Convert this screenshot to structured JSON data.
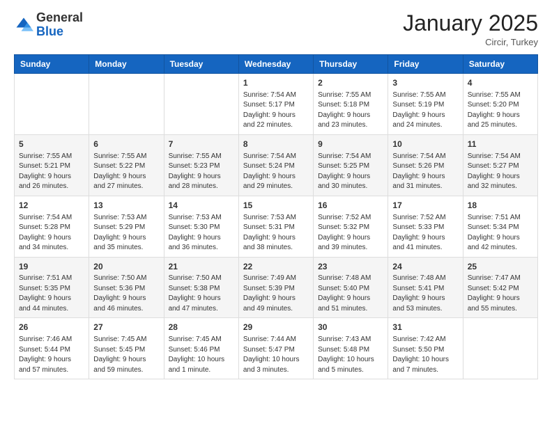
{
  "header": {
    "logo_general": "General",
    "logo_blue": "Blue",
    "month_title": "January 2025",
    "subtitle": "Circir, Turkey"
  },
  "days_of_week": [
    "Sunday",
    "Monday",
    "Tuesday",
    "Wednesday",
    "Thursday",
    "Friday",
    "Saturday"
  ],
  "weeks": [
    [
      {
        "day": "",
        "info": ""
      },
      {
        "day": "",
        "info": ""
      },
      {
        "day": "",
        "info": ""
      },
      {
        "day": "1",
        "info": "Sunrise: 7:54 AM\nSunset: 5:17 PM\nDaylight: 9 hours\nand 22 minutes."
      },
      {
        "day": "2",
        "info": "Sunrise: 7:55 AM\nSunset: 5:18 PM\nDaylight: 9 hours\nand 23 minutes."
      },
      {
        "day": "3",
        "info": "Sunrise: 7:55 AM\nSunset: 5:19 PM\nDaylight: 9 hours\nand 24 minutes."
      },
      {
        "day": "4",
        "info": "Sunrise: 7:55 AM\nSunset: 5:20 PM\nDaylight: 9 hours\nand 25 minutes."
      }
    ],
    [
      {
        "day": "5",
        "info": "Sunrise: 7:55 AM\nSunset: 5:21 PM\nDaylight: 9 hours\nand 26 minutes."
      },
      {
        "day": "6",
        "info": "Sunrise: 7:55 AM\nSunset: 5:22 PM\nDaylight: 9 hours\nand 27 minutes."
      },
      {
        "day": "7",
        "info": "Sunrise: 7:55 AM\nSunset: 5:23 PM\nDaylight: 9 hours\nand 28 minutes."
      },
      {
        "day": "8",
        "info": "Sunrise: 7:54 AM\nSunset: 5:24 PM\nDaylight: 9 hours\nand 29 minutes."
      },
      {
        "day": "9",
        "info": "Sunrise: 7:54 AM\nSunset: 5:25 PM\nDaylight: 9 hours\nand 30 minutes."
      },
      {
        "day": "10",
        "info": "Sunrise: 7:54 AM\nSunset: 5:26 PM\nDaylight: 9 hours\nand 31 minutes."
      },
      {
        "day": "11",
        "info": "Sunrise: 7:54 AM\nSunset: 5:27 PM\nDaylight: 9 hours\nand 32 minutes."
      }
    ],
    [
      {
        "day": "12",
        "info": "Sunrise: 7:54 AM\nSunset: 5:28 PM\nDaylight: 9 hours\nand 34 minutes."
      },
      {
        "day": "13",
        "info": "Sunrise: 7:53 AM\nSunset: 5:29 PM\nDaylight: 9 hours\nand 35 minutes."
      },
      {
        "day": "14",
        "info": "Sunrise: 7:53 AM\nSunset: 5:30 PM\nDaylight: 9 hours\nand 36 minutes."
      },
      {
        "day": "15",
        "info": "Sunrise: 7:53 AM\nSunset: 5:31 PM\nDaylight: 9 hours\nand 38 minutes."
      },
      {
        "day": "16",
        "info": "Sunrise: 7:52 AM\nSunset: 5:32 PM\nDaylight: 9 hours\nand 39 minutes."
      },
      {
        "day": "17",
        "info": "Sunrise: 7:52 AM\nSunset: 5:33 PM\nDaylight: 9 hours\nand 41 minutes."
      },
      {
        "day": "18",
        "info": "Sunrise: 7:51 AM\nSunset: 5:34 PM\nDaylight: 9 hours\nand 42 minutes."
      }
    ],
    [
      {
        "day": "19",
        "info": "Sunrise: 7:51 AM\nSunset: 5:35 PM\nDaylight: 9 hours\nand 44 minutes."
      },
      {
        "day": "20",
        "info": "Sunrise: 7:50 AM\nSunset: 5:36 PM\nDaylight: 9 hours\nand 46 minutes."
      },
      {
        "day": "21",
        "info": "Sunrise: 7:50 AM\nSunset: 5:38 PM\nDaylight: 9 hours\nand 47 minutes."
      },
      {
        "day": "22",
        "info": "Sunrise: 7:49 AM\nSunset: 5:39 PM\nDaylight: 9 hours\nand 49 minutes."
      },
      {
        "day": "23",
        "info": "Sunrise: 7:48 AM\nSunset: 5:40 PM\nDaylight: 9 hours\nand 51 minutes."
      },
      {
        "day": "24",
        "info": "Sunrise: 7:48 AM\nSunset: 5:41 PM\nDaylight: 9 hours\nand 53 minutes."
      },
      {
        "day": "25",
        "info": "Sunrise: 7:47 AM\nSunset: 5:42 PM\nDaylight: 9 hours\nand 55 minutes."
      }
    ],
    [
      {
        "day": "26",
        "info": "Sunrise: 7:46 AM\nSunset: 5:44 PM\nDaylight: 9 hours\nand 57 minutes."
      },
      {
        "day": "27",
        "info": "Sunrise: 7:45 AM\nSunset: 5:45 PM\nDaylight: 9 hours\nand 59 minutes."
      },
      {
        "day": "28",
        "info": "Sunrise: 7:45 AM\nSunset: 5:46 PM\nDaylight: 10 hours\nand 1 minute."
      },
      {
        "day": "29",
        "info": "Sunrise: 7:44 AM\nSunset: 5:47 PM\nDaylight: 10 hours\nand 3 minutes."
      },
      {
        "day": "30",
        "info": "Sunrise: 7:43 AM\nSunset: 5:48 PM\nDaylight: 10 hours\nand 5 minutes."
      },
      {
        "day": "31",
        "info": "Sunrise: 7:42 AM\nSunset: 5:50 PM\nDaylight: 10 hours\nand 7 minutes."
      },
      {
        "day": "",
        "info": ""
      }
    ]
  ]
}
